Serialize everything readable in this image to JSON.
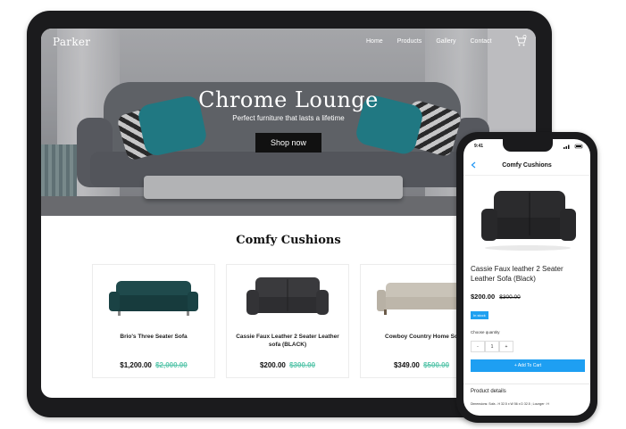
{
  "site": {
    "brand": "Parker",
    "nav": [
      "Home",
      "Products",
      "Gallery",
      "Contact"
    ],
    "cart_icon": "cart-icon"
  },
  "hero": {
    "title": "Chrome Lounge",
    "subtitle": "Perfect furniture that lasts a lifetime",
    "cta": "Shop now"
  },
  "section": {
    "title": "Comfy Cushions"
  },
  "products": [
    {
      "name": "Brio's Three Seater Sofa",
      "price": "$1,200.00",
      "old_price": "$2,000.00",
      "color": "#1f4a4c"
    },
    {
      "name": "Cassie Faux Leather 2 Seater Leather sofa (BLACK)",
      "price": "$200.00",
      "old_price": "$300.00",
      "color": "#3a3a3d"
    },
    {
      "name": "Cowboy Country Home So",
      "price": "$349.00",
      "old_price": "$500.00",
      "color": "#c9c3b8"
    }
  ],
  "phone": {
    "time": "9:41",
    "header_title": "Comfy Cushions",
    "back_icon": "chevron-left-icon",
    "product_name": "Cassie Faux leather 2 Seater Leather Sofa (Black)",
    "price": "$200.00",
    "old_price": "$300.00",
    "stock_badge": "In stock",
    "quantity_label": "Choose quantity",
    "quantity_value": "1",
    "minus": "-",
    "plus": "+",
    "add_to_cart": "+ Add To Cart",
    "details_title": "Product details",
    "details_text": "Dimensions: Sofa - H 32.5 x W 56 x D 32.5 ; Lounger : H"
  },
  "colors": {
    "accent_blue": "#1e9ff2",
    "old_price_green": "#5cc7ad"
  }
}
